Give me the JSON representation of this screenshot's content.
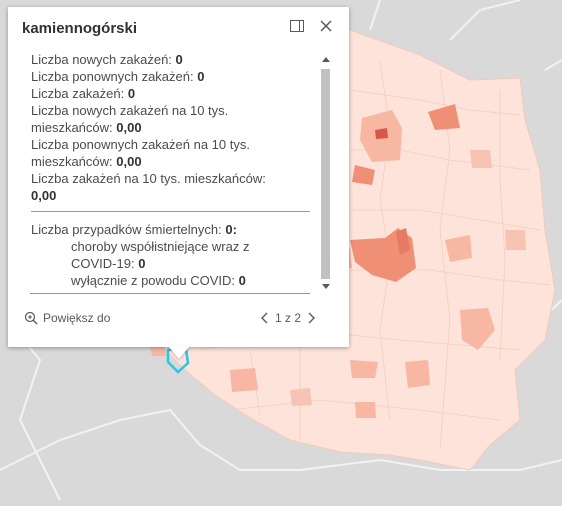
{
  "popup": {
    "title": "kamiennogórski",
    "rows": [
      {
        "label": "Liczba nowych zakażeń: ",
        "value": "0"
      },
      {
        "label": "Liczba ponownych zakażeń: ",
        "value": "0"
      },
      {
        "label": "Liczba zakażeń: ",
        "value": "0"
      },
      {
        "label": "Liczba nowych zakażeń na 10 tys.",
        "label2": "mieszkańców: ",
        "value": "0,00"
      },
      {
        "label": "Liczba ponownych zakażeń na 10 tys.",
        "label2": "mieszkańców: ",
        "value": "0,00"
      },
      {
        "label": "Liczba zakażeń na 10 tys. mieszkańców:",
        "value": "0,00"
      }
    ],
    "deaths": {
      "label": "Liczba przypadków śmiertelnych: ",
      "value": "0:",
      "comorb_label": "choroby współistniejące wraz z",
      "comorb_label2": "COVID-19: ",
      "comorb_value": "0",
      "only_label": "wyłącznie z powodu COVID: ",
      "only_value": "0"
    },
    "footer": {
      "zoom_label": "Powiększ do",
      "pager_text": "1 z 2"
    }
  },
  "colors": {
    "map_background": "#d9d9d9",
    "country_fill": "#fde3da",
    "region_medium": "#f7b7a3",
    "region_dark": "#ef8f75",
    "region_darkest": "#d9574a",
    "highlight": "#29c5e6"
  }
}
